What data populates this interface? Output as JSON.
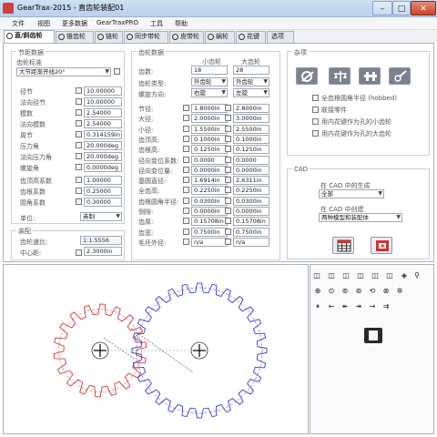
{
  "window": {
    "title": "GearTrax-2015 - 直齿轮装配01"
  },
  "menu": [
    "文件",
    "视图",
    "更多数据",
    "GearTraxPRO",
    "工具",
    "帮助"
  ],
  "tabs": [
    "直/斜齿轮",
    "锥齿轮",
    "链轮",
    "同步带轮",
    "皮带轮",
    "蜗轮",
    "花键",
    "选项"
  ],
  "pitch_data": {
    "title": "节距数据",
    "tooth_std_label": "齿轮标准",
    "tooth_std_value": "大节距渐开线20°",
    "rows": [
      {
        "label": "径节",
        "value": "10.00000"
      },
      {
        "label": "法向径节",
        "value": "10.00000"
      },
      {
        "label": "模数",
        "value": "2.54000"
      },
      {
        "label": "法向模数",
        "value": "2.54000"
      },
      {
        "label": "周节",
        "value": "0.314159in"
      },
      {
        "label": "压力角",
        "value": "20.000deg"
      },
      {
        "label": "法向压力角",
        "value": "20.000deg"
      },
      {
        "label": "螺旋角",
        "value": "0.0000deg"
      }
    ],
    "coef_rows": [
      {
        "label": "齿顶高系数",
        "value": "1.00000"
      },
      {
        "label": "齿根系数",
        "value": "0.25000"
      },
      {
        "label": "圆角系数",
        "value": "0.30000"
      }
    ],
    "unit_label": "单位:",
    "unit_value": "英制"
  },
  "assembly": {
    "title": "装配",
    "ratio_label": "齿轮速比:",
    "ratio_value": "1:1.5556",
    "center_label": "中心距:",
    "center_value": "2.3000in"
  },
  "gear_data": {
    "title": "齿轮数据",
    "col_small": "小齿轮",
    "col_large": "大齿轮",
    "teeth_label": "齿数:",
    "teeth_small": "18",
    "teeth_large": "28",
    "type_label": "齿轮类型:",
    "type_small": "外齿轮",
    "type_large": "外齿轮",
    "hand_label": "螺旋方向:",
    "hand_small": "右旋",
    "hand_large": "左旋",
    "rows": [
      {
        "label": "节径:",
        "small": "1.8000in",
        "large": "2.8000in"
      },
      {
        "label": "大径:",
        "small": "2.0000in",
        "large": "3.0000in"
      },
      {
        "label": "小径:",
        "small": "1.5500in",
        "large": "2.5500in"
      },
      {
        "label": "齿顶高:",
        "small": "0.1000in",
        "large": "0.1000in"
      },
      {
        "label": "齿根高:",
        "small": "0.1250in",
        "large": "0.1250in"
      },
      {
        "label": "径向变位系数:",
        "small": "0.0000",
        "large": "0.0000"
      },
      {
        "label": "径向变位量:",
        "small": "0.0000in",
        "large": "0.0000in"
      },
      {
        "label": "基圆直径:",
        "small": "1.6914in",
        "large": "2.6311in"
      },
      {
        "label": "全齿高:",
        "small": "0.2250in",
        "large": "0.2250in"
      },
      {
        "label": "齿根圆角半径:",
        "small": "0.0300in",
        "large": "0.0300in"
      },
      {
        "label": "侧隙:",
        "small": "0.0000in",
        "large": "0.0000in"
      },
      {
        "label": "齿厚:",
        "small": "0.15708in",
        "large": "0.15708in"
      },
      {
        "label": "齿宽:",
        "small": "0.7500in",
        "large": "0.7500in"
      },
      {
        "label": "毛坯外径:",
        "small": "n/a",
        "large": "n/a"
      }
    ]
  },
  "misc": {
    "title": "杂项",
    "options": [
      "全齿根圆角半径 (hobbed)",
      "联接零件",
      "用内花键作为孔的小齿轮",
      "用内花键作为孔的大齿轮"
    ]
  },
  "cad": {
    "title": "CAD",
    "gen_label": "在 CAD 中的生成",
    "gen_value": "全部",
    "create_label": "在 CAD 中创建",
    "create_value": "两种模型和装配体"
  },
  "viewer": {
    "small_gear_color": "#cc3b3b",
    "large_gear_color": "#3b3bcc",
    "small_teeth": 18,
    "large_teeth": 28
  }
}
